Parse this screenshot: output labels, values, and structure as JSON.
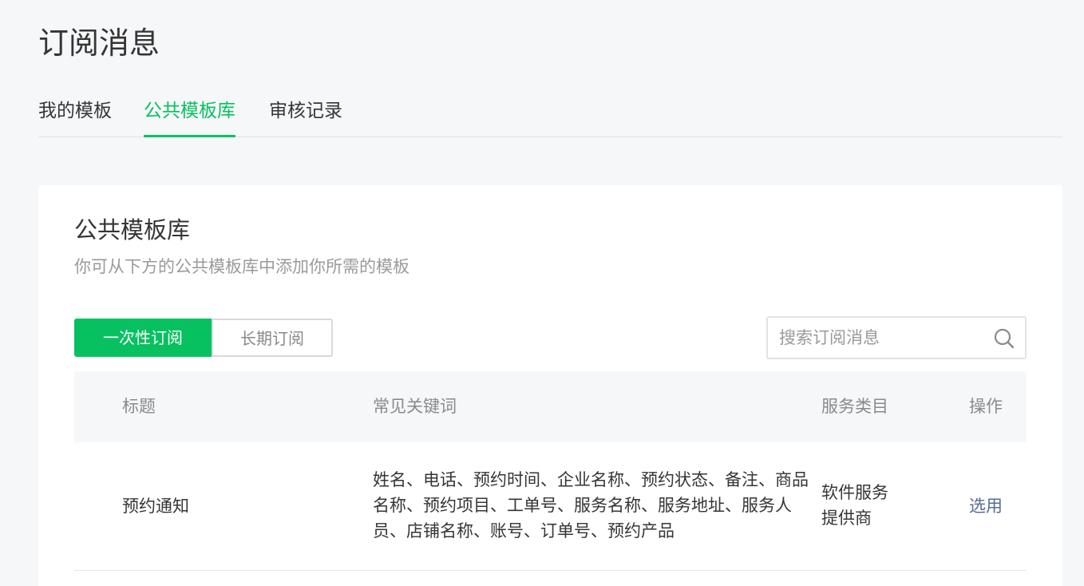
{
  "page": {
    "title": "订阅消息"
  },
  "tabs": [
    {
      "label": "我的模板",
      "active": false
    },
    {
      "label": "公共模板库",
      "active": true
    },
    {
      "label": "审核记录",
      "active": false
    }
  ],
  "card": {
    "title": "公共模板库",
    "description": "你可从下方的公共模板库中添加你所需的模板"
  },
  "segment": {
    "options": [
      {
        "label": "一次性订阅",
        "active": true
      },
      {
        "label": "长期订阅",
        "active": false
      }
    ]
  },
  "search": {
    "placeholder": "搜索订阅消息",
    "value": "",
    "icon": "search-icon"
  },
  "table": {
    "columns": [
      "标题",
      "常见关键词",
      "服务类目",
      "操作"
    ],
    "rows": [
      {
        "title": "预约通知",
        "keywords": "姓名、电话、预约时间、企业名称、预约状态、备注、商品名称、预约项目、工单号、服务名称、服务地址、服务人员、店铺名称、账号、订单号、预约产品",
        "category": "软件服务提供商",
        "action": "选用"
      }
    ]
  },
  "colors": {
    "accent": "#07c160",
    "link": "#576b95",
    "background": "#f6f7f9",
    "text": "#353535",
    "muted": "#9a9a9a"
  }
}
